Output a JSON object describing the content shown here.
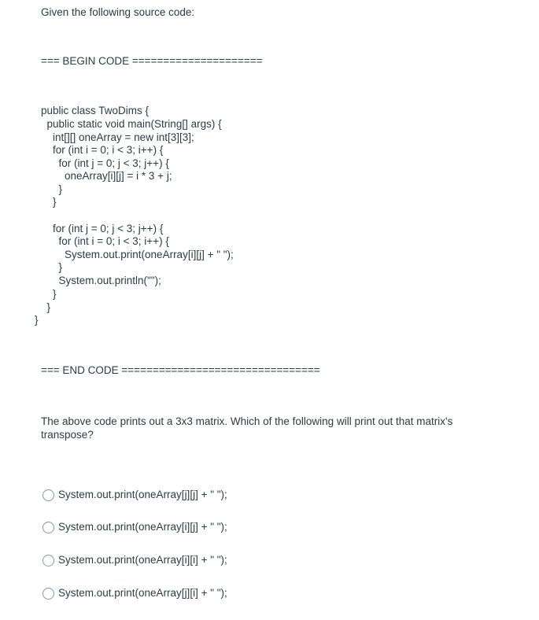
{
  "intro": "Given the following source code:",
  "begin_marker": "=== BEGIN CODE =====================",
  "code_lines": [
    "public class TwoDims {",
    "  public static void main(String[] args) {",
    "    int[][] oneArray = new int[3][3];",
    "    for (int i = 0; i < 3; i++) {",
    "      for (int j = 0; j < 3; j++) {",
    "        oneArray[i][j] = i * 3 + j;",
    "      }",
    "    }",
    "",
    "    for (int j = 0; j < 3; j++) {",
    "      for (int i = 0; i < 3; i++) {",
    "        System.out.print(oneArray[i][j] + \" \");",
    "      }",
    "      System.out.println(\"\");",
    "    }",
    "  }",
    "}"
  ],
  "end_marker": "=== END CODE ================================",
  "question": "The above code prints out a 3x3 matrix. Which of the following will print out that matrix's transpose?",
  "options": [
    {
      "label": "System.out.print(oneArray[j][j] + \" \");",
      "selected": false
    },
    {
      "label": "System.out.print(oneArray[i][j] + \" \");",
      "selected": false
    },
    {
      "label": "System.out.print(oneArray[i][i] + \" \");",
      "selected": false
    },
    {
      "label": "System.out.print(oneArray[j][i] + \" \");",
      "selected": false
    }
  ]
}
